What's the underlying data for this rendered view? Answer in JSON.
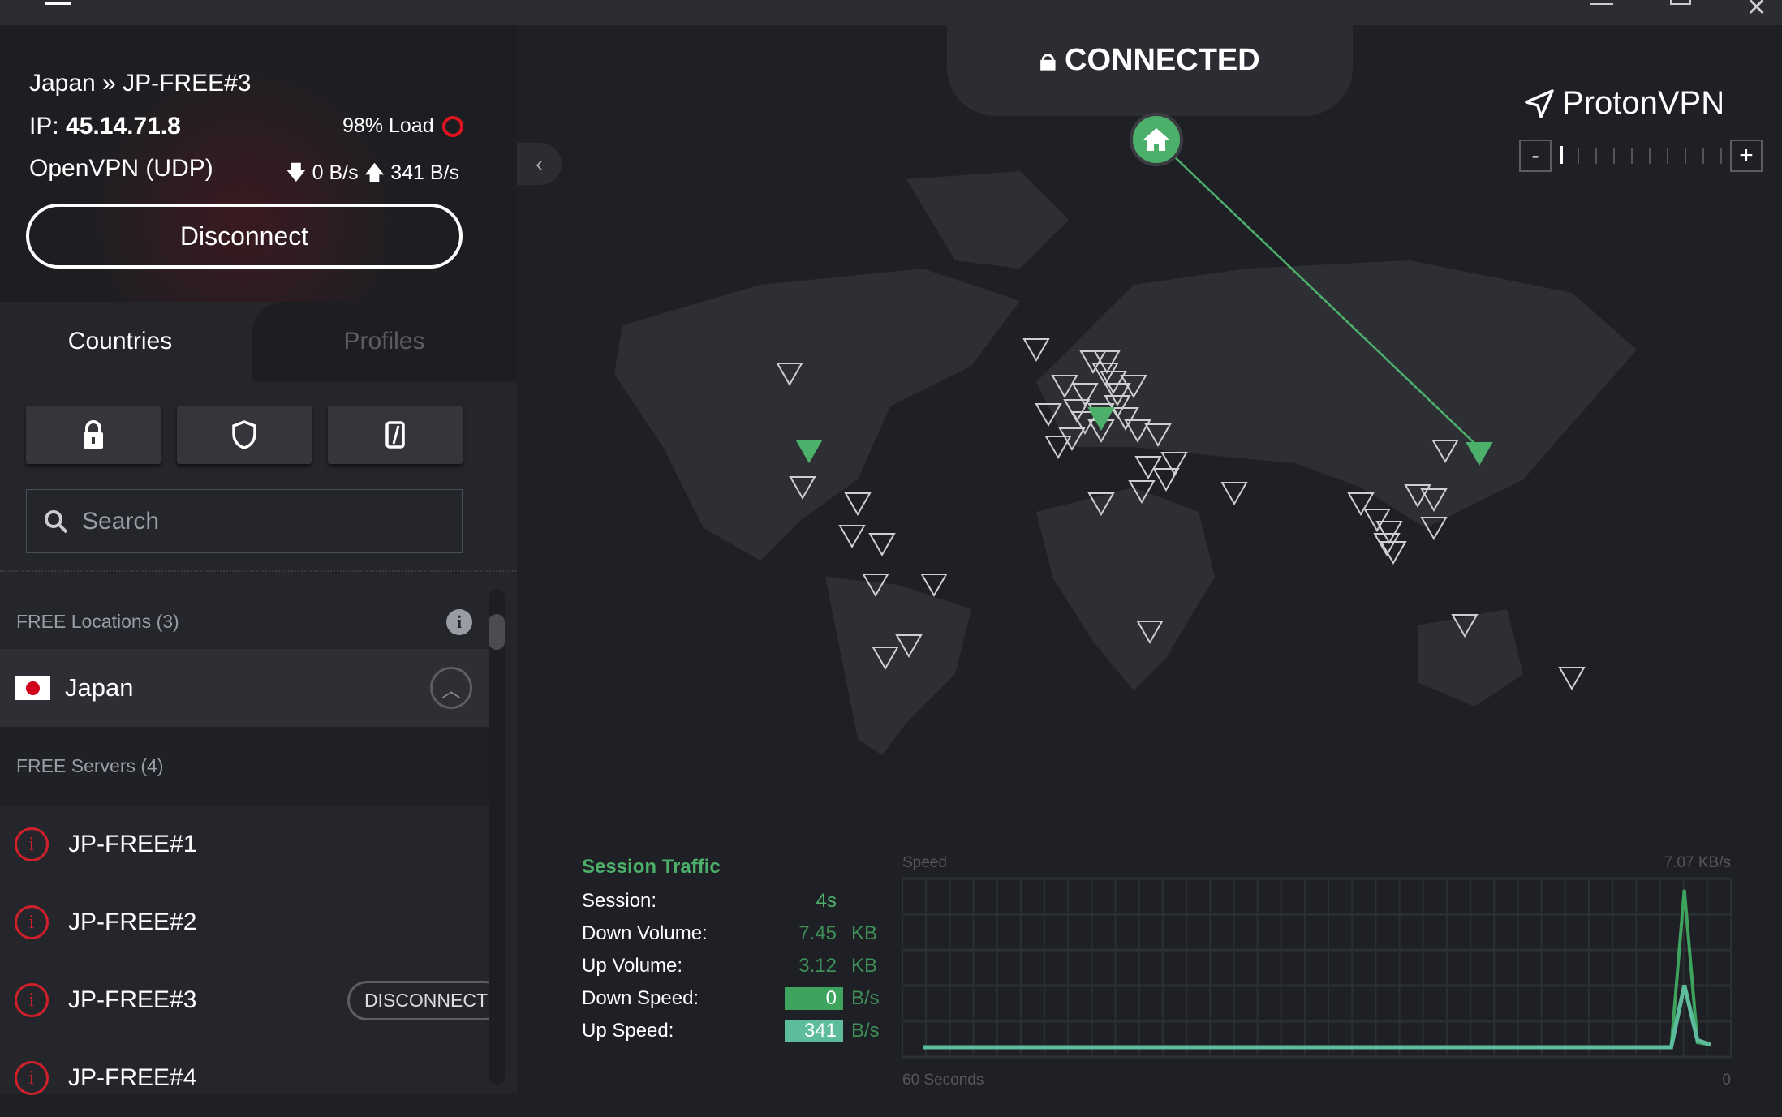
{
  "titlebar": {
    "menu_icon": "hamburger-icon",
    "controls": [
      "minimize",
      "maximize",
      "close"
    ]
  },
  "connection": {
    "location": "Japan » JP-FREE#3",
    "ip_label": "IP:",
    "ip": "45.14.71.8",
    "load": "98% Load",
    "protocol": "OpenVPN (UDP)",
    "down_speed": "0 B/s",
    "up_speed": "341 B/s",
    "disconnect_label": "Disconnect",
    "load_color": "#e0141e"
  },
  "tabs": [
    {
      "label": "Countries",
      "active": true
    },
    {
      "label": "Profiles",
      "active": false
    }
  ],
  "filters": [
    "lock-icon",
    "shield-icon",
    "tor-icon"
  ],
  "search": {
    "placeholder": "Search",
    "value": ""
  },
  "list": {
    "section": "FREE Locations (3)",
    "country": "Japan",
    "subsection": "FREE Servers (4)",
    "servers": [
      {
        "name": "JP-FREE#1"
      },
      {
        "name": "JP-FREE#2"
      },
      {
        "name": "JP-FREE#3",
        "action": "DISCONNECT"
      },
      {
        "name": "JP-FREE#4"
      }
    ]
  },
  "map": {
    "status": "CONNECTED",
    "brand": "ProtonVPN",
    "zoom_minus": "-",
    "zoom_plus": "+",
    "accent": "#4caf6a"
  },
  "traffic": {
    "title": "Session Traffic",
    "session_label": "Session:",
    "session": "4s",
    "down_volume_label": "Down Volume:",
    "down_volume": "7.45",
    "down_volume_unit": "KB",
    "up_volume_label": "Up Volume:",
    "up_volume": "3.12",
    "up_volume_unit": "KB",
    "down_speed_label": "Down Speed:",
    "down_speed": "0",
    "down_speed_unit": "B/s",
    "up_speed_label": "Up Speed:",
    "up_speed": "341",
    "up_speed_unit": "B/s"
  },
  "chart_data": {
    "type": "line",
    "ylabel": "Speed",
    "ymax_label": "7.07  KB/s",
    "ylim": [
      0,
      7.07
    ],
    "xlabel_left": "60 Seconds",
    "xlabel_right": "0",
    "grid": true,
    "x": [
      60,
      59,
      58,
      57,
      56,
      55,
      54,
      53,
      52,
      51,
      50,
      49,
      48,
      47,
      46,
      45,
      44,
      43,
      42,
      41,
      40,
      39,
      38,
      37,
      36,
      35,
      34,
      33,
      32,
      31,
      30,
      29,
      28,
      27,
      26,
      25,
      24,
      23,
      22,
      21,
      20,
      19,
      18,
      17,
      16,
      15,
      14,
      13,
      12,
      11,
      10,
      9,
      8,
      7,
      6,
      5,
      4,
      3,
      2,
      1,
      0
    ],
    "series": [
      {
        "color": "#3da35d",
        "values": [
          0,
          0,
          0,
          0,
          0,
          0,
          0,
          0,
          0,
          0,
          0,
          0,
          0,
          0,
          0,
          0,
          0,
          0,
          0,
          0,
          0,
          0,
          0,
          0,
          0,
          0,
          0,
          0,
          0,
          0,
          0,
          0,
          0,
          0,
          0,
          0,
          0,
          0,
          0,
          0,
          0,
          0,
          0,
          0,
          0,
          0,
          0,
          0,
          0,
          0,
          0,
          0,
          0,
          0,
          0,
          0,
          0,
          0,
          6.6,
          0.2,
          0.1
        ]
      },
      {
        "color": "#5cbc9c",
        "values": [
          0,
          0,
          0,
          0,
          0,
          0,
          0,
          0,
          0,
          0,
          0,
          0,
          0,
          0,
          0,
          0,
          0,
          0,
          0,
          0,
          0,
          0,
          0,
          0,
          0,
          0,
          0,
          0,
          0,
          0,
          0,
          0,
          0,
          0,
          0,
          0,
          0,
          0,
          0,
          0,
          0,
          0,
          0,
          0,
          0,
          0,
          0,
          0,
          0,
          0,
          0,
          0,
          0,
          0,
          0,
          0,
          0,
          0,
          2.6,
          0.3,
          0.1
        ]
      }
    ]
  }
}
